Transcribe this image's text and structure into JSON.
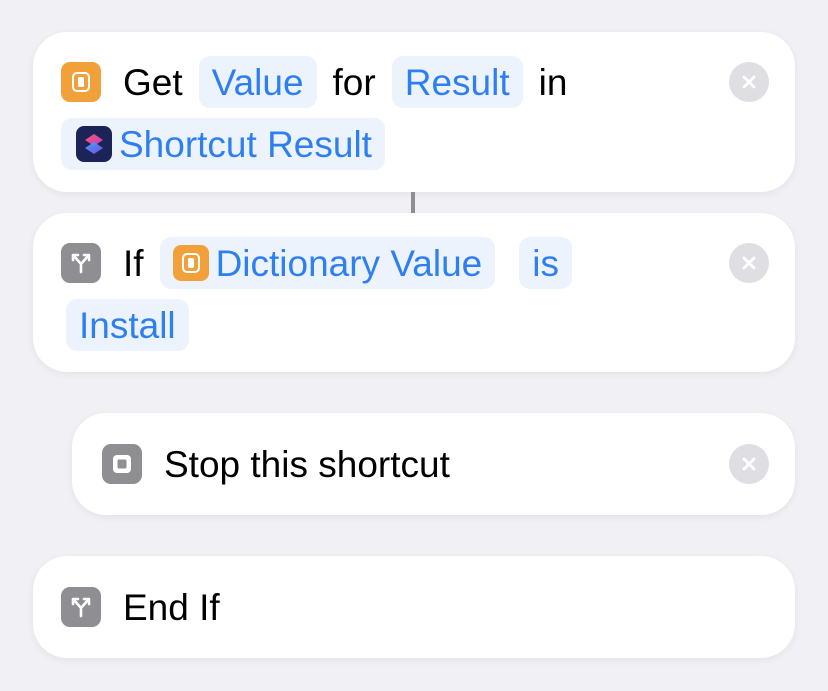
{
  "actions": {
    "get_value": {
      "word_get": "Get",
      "token_key": "Value",
      "word_for": "for",
      "token_result": "Result",
      "word_in": "in",
      "token_source": "Shortcut Result",
      "icon": "dictionary-icon"
    },
    "if": {
      "word_if": "If",
      "token_input": "Dictionary Value",
      "token_condition": "is",
      "token_value": "Install",
      "icon": "branch-icon"
    },
    "stop": {
      "label": "Stop this shortcut",
      "icon": "stop-icon"
    },
    "end_if": {
      "label": "End If",
      "icon": "branch-icon"
    }
  },
  "colors": {
    "background": "#f0f0f5",
    "card": "#ffffff",
    "token_text": "#2e7ff0",
    "token_bg": "#edf3fc",
    "orange_icon": "#f2a03a",
    "gray_icon": "#8e8e93",
    "close_bg": "#dedee3"
  }
}
